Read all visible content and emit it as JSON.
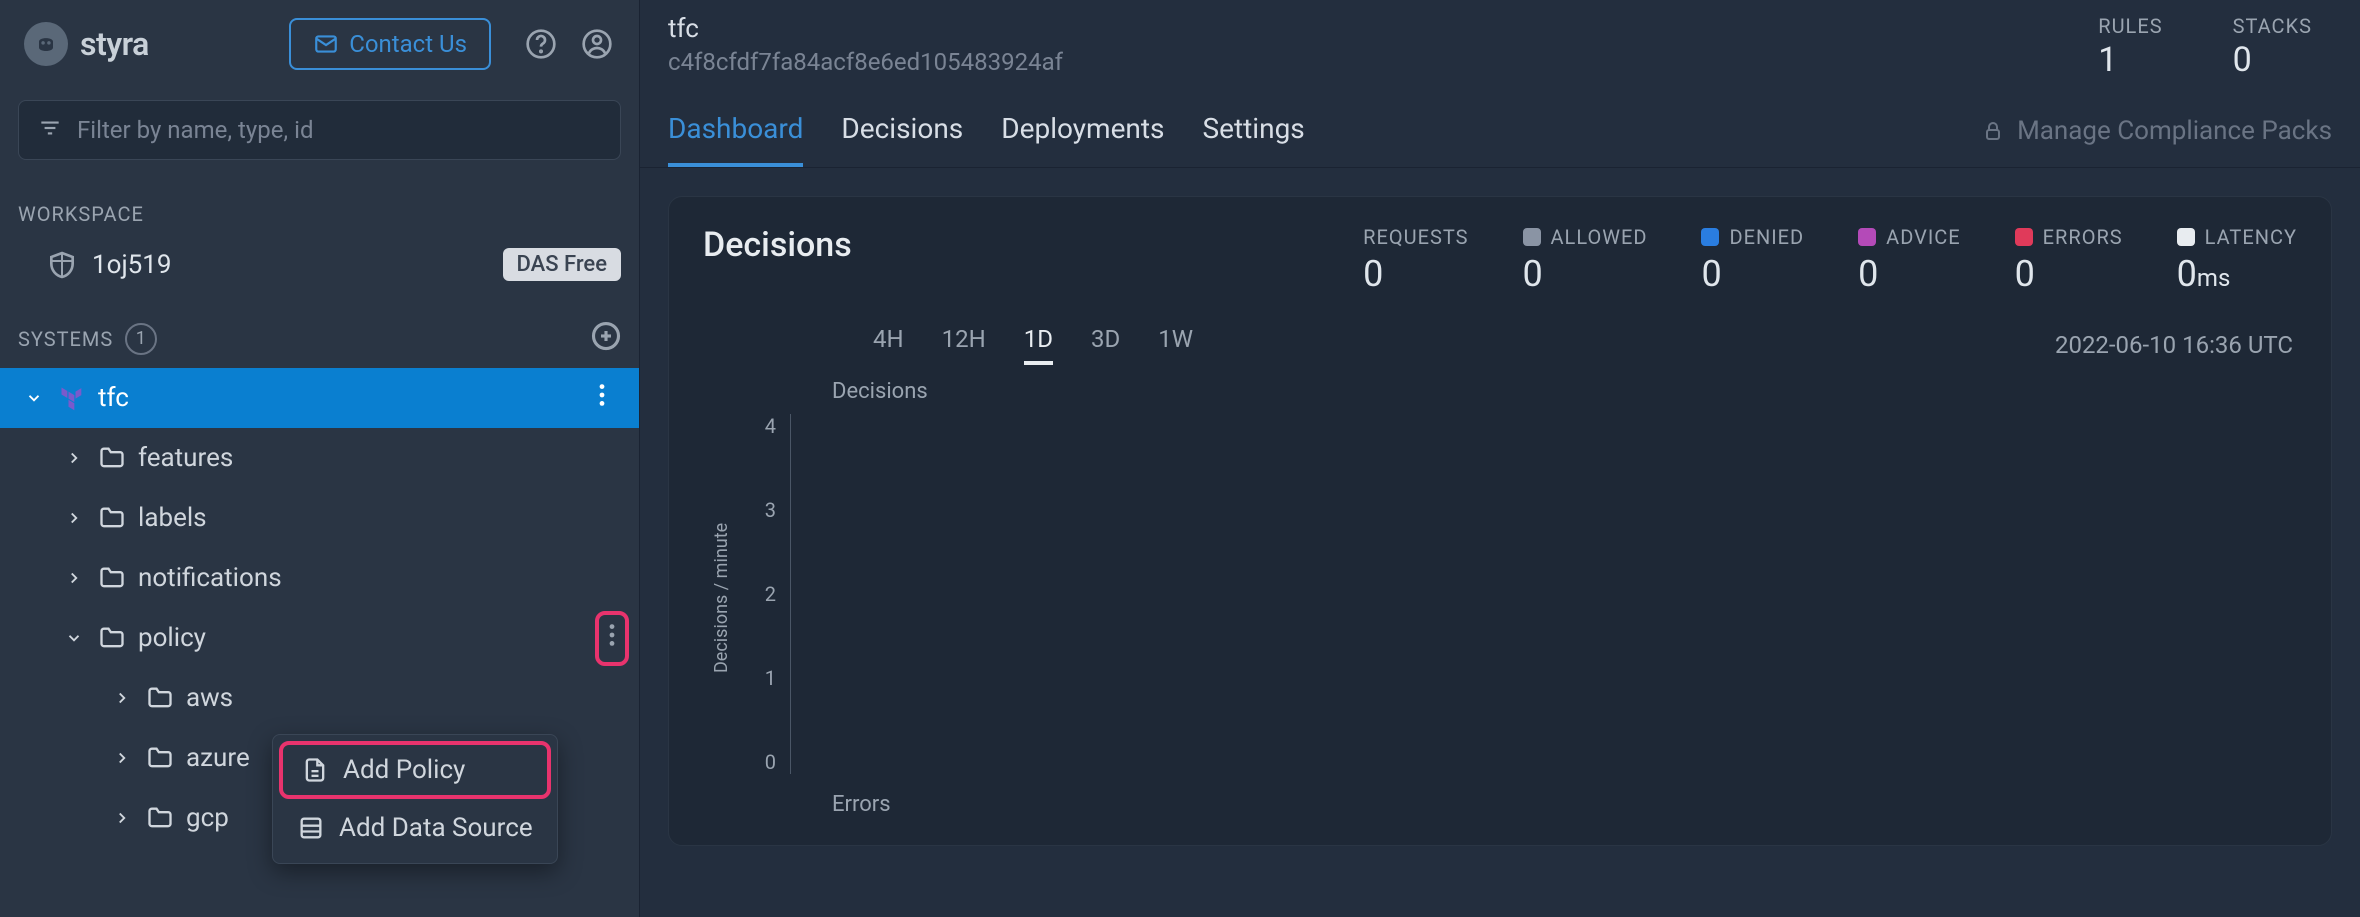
{
  "brand": "styra",
  "contact_label": "Contact Us",
  "search": {
    "placeholder": "Filter by name, type, id"
  },
  "workspace": {
    "label": "WORKSPACE",
    "name": "1oj519",
    "badge": "DAS Free"
  },
  "systems": {
    "label": "SYSTEMS",
    "count": "1",
    "tree": {
      "root": {
        "label": "tfc"
      },
      "features": "features",
      "labels": "labels",
      "notifications": "notifications",
      "policy": "policy",
      "aws": "aws",
      "azure": "azure",
      "gcp": "gcp"
    }
  },
  "context_menu": {
    "add_policy": "Add Policy",
    "add_data_source": "Add Data Source"
  },
  "header": {
    "title": "tfc",
    "subtitle": "c4f8cfdf7fa84acf8e6ed105483924af",
    "rules": {
      "label": "RULES",
      "value": "1"
    },
    "stacks": {
      "label": "STACKS",
      "value": "0"
    }
  },
  "tabs": {
    "dashboard": "Dashboard",
    "decisions": "Decisions",
    "deployments": "Deployments",
    "settings": "Settings",
    "manage": "Manage Compliance Packs"
  },
  "card": {
    "title": "Decisions",
    "metrics": {
      "requests": {
        "label": "REQUESTS",
        "value": "0"
      },
      "allowed": {
        "label": "ALLOWED",
        "value": "0",
        "color": "#8a94a4"
      },
      "denied": {
        "label": "DENIED",
        "value": "0",
        "color": "#2a7de0"
      },
      "advice": {
        "label": "ADVICE",
        "value": "0",
        "color": "#b44ab8"
      },
      "errors": {
        "label": "ERRORS",
        "value": "0",
        "color": "#e03a5a"
      },
      "latency": {
        "label": "LATENCY",
        "value": "0",
        "unit": "ms",
        "color": "#e8ecf0"
      }
    },
    "ranges": {
      "r4h": "4H",
      "r12h": "12H",
      "r1d": "1D",
      "r3d": "3D",
      "r1w": "1W"
    },
    "timestamp": "2022-06-10 16:36 UTC"
  },
  "chart_data": {
    "type": "line",
    "title": "Decisions",
    "ylabel": "Decisions / minute",
    "ylim": [
      0,
      4
    ],
    "y_ticks": [
      "4",
      "3",
      "2",
      "1",
      "0"
    ],
    "series": [],
    "errors_title": "Errors"
  }
}
